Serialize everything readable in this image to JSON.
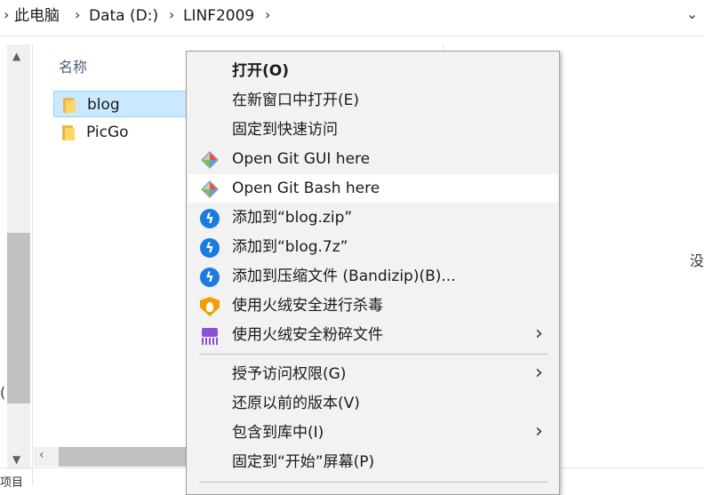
{
  "breadcrumb": {
    "items": [
      "此电脑",
      "Data (D:)",
      "LINF2009"
    ],
    "separator": "›"
  },
  "file_list": {
    "column_name": "名称",
    "files": [
      {
        "name": "blog",
        "selected": true
      },
      {
        "name": "PicGo",
        "selected": false
      }
    ]
  },
  "fragments": {
    "left": "(",
    "bottom": "项目",
    "right": "没"
  },
  "context_menu": {
    "items": [
      {
        "label": "打开(O)",
        "bold": true,
        "icon": null
      },
      {
        "label": "在新窗口中打开(E)",
        "icon": null
      },
      {
        "label": "固定到快速访问",
        "icon": null
      },
      {
        "label": "Open Git GUI here",
        "icon": "git-icon"
      },
      {
        "label": "Open Git Bash here",
        "icon": "git-icon",
        "highlighted": true
      },
      {
        "label": "添加到“blog.zip”",
        "icon": "bandizip-icon"
      },
      {
        "label": "添加到“blog.7z”",
        "icon": "bandizip-icon"
      },
      {
        "label": "添加到压缩文件 (Bandizip)(B)...",
        "icon": "bandizip-icon"
      },
      {
        "label": "使用火绒安全进行杀毒",
        "icon": "huorong-shield-icon"
      },
      {
        "label": "使用火绒安全粉碎文件",
        "icon": "shredder-icon",
        "submenu": true
      },
      {
        "label": "授予访问权限(G)",
        "icon": null,
        "submenu": true
      },
      {
        "label": "还原以前的版本(V)",
        "icon": null
      },
      {
        "label": "包含到库中(I)",
        "icon": null,
        "submenu": true
      },
      {
        "label": "固定到“开始”屏幕(P)",
        "icon": null
      }
    ]
  },
  "colors": {
    "selection_bg": "#cce8ff",
    "menu_bg": "#f2f2f2",
    "bandizip_blue": "#1b7ce0",
    "huorong_orange": "#f29f05",
    "shredder_purple": "#8d4fd8"
  }
}
